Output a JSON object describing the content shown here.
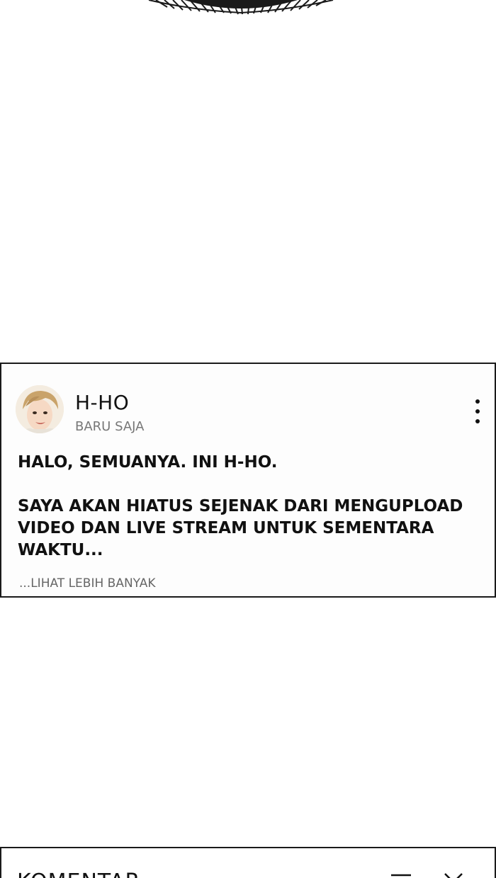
{
  "post": {
    "author": "H-HO",
    "time": "BARU SAJA",
    "paragraphs": [
      "HALO, SEMUANYA. INI H-HO.",
      "SAYA AKAN HIATUS SEJENAK DARI MENGUPLOAD VIDEO DAN LIVE STREAM UNTUK SEMENTARA WAKTU..."
    ],
    "see_more": "...LIHAT LEBIH BANYAK",
    "more_icon": "more-vertical-icon"
  },
  "comments": {
    "title": "KOMENTAR",
    "sort_icon": "sort-icon",
    "close_icon": "close-icon"
  }
}
